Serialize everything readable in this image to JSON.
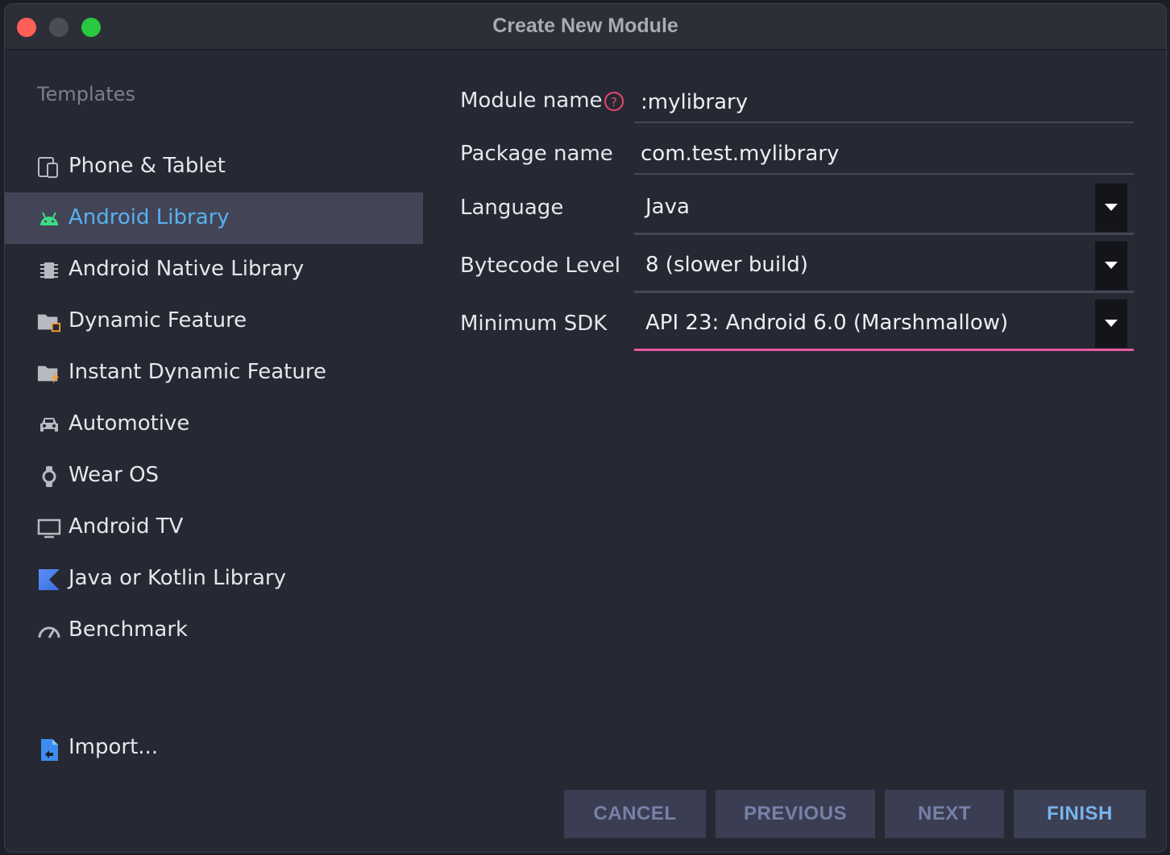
{
  "window": {
    "title": "Create New Module"
  },
  "sidebar": {
    "heading": "Templates",
    "items": [
      {
        "label": "Phone & Tablet",
        "icon": "phone-tablet-icon"
      },
      {
        "label": "Android Library",
        "icon": "android-icon",
        "selected": true
      },
      {
        "label": "Android Native Library",
        "icon": "chip-icon"
      },
      {
        "label": "Dynamic Feature",
        "icon": "folder-module-icon"
      },
      {
        "label": "Instant Dynamic Feature",
        "icon": "folder-lightning-icon"
      },
      {
        "label": "Automotive",
        "icon": "car-icon"
      },
      {
        "label": "Wear OS",
        "icon": "watch-icon"
      },
      {
        "label": "Android TV",
        "icon": "tv-icon"
      },
      {
        "label": "Java or Kotlin Library",
        "icon": "kotlin-icon"
      },
      {
        "label": "Benchmark",
        "icon": "gauge-icon"
      }
    ],
    "import_label": "Import..."
  },
  "form": {
    "module_name": {
      "label": "Module name",
      "value": ":mylibrary"
    },
    "package_name": {
      "label": "Package name",
      "value": "com.test.mylibrary"
    },
    "language": {
      "label": "Language",
      "value": "Java"
    },
    "bytecode_level": {
      "label": "Bytecode Level",
      "value": "8 (slower build)"
    },
    "minimum_sdk": {
      "label": "Minimum SDK",
      "value": "API 23: Android 6.0 (Marshmallow)"
    }
  },
  "buttons": {
    "cancel": "CANCEL",
    "previous": "PREVIOUS",
    "next": "NEXT",
    "finish": "FINISH"
  },
  "colors": {
    "selected_text": "#58b0f0",
    "focus_underline": "#e85a9f",
    "help_icon": "#e8486d"
  }
}
